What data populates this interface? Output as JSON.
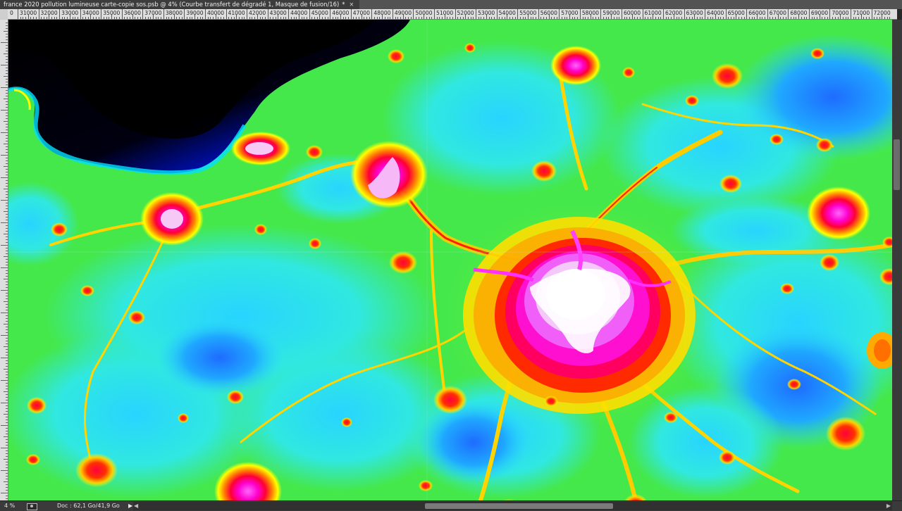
{
  "document_tab": {
    "title": "france 2020 pollution lumineuse carte-copie sos.psb @ 4% (Courbe transfert de dégradé 1, Masque de fusion/16)",
    "modified_marker": "*",
    "close_icon": "close-icon"
  },
  "ruler": {
    "start_label": "0",
    "labels": [
      "31000",
      "32000",
      "33000",
      "34000",
      "35000",
      "36000",
      "37000",
      "38000",
      "39000",
      "40000",
      "41000",
      "42000",
      "43000",
      "44000",
      "45000",
      "46000",
      "47000",
      "48000",
      "49000",
      "50000",
      "51000",
      "52000",
      "53000",
      "54000",
      "55000",
      "56000",
      "57000",
      "58000",
      "59000",
      "60000",
      "61000",
      "62000",
      "63000",
      "64000",
      "65000",
      "66000",
      "67000",
      "68000",
      "69000",
      "70000",
      "71000",
      "72000"
    ]
  },
  "status_bar": {
    "zoom": "4 %",
    "doc_info": "Doc : 62,1 Go/41,9 Go",
    "arrow": "▶",
    "scroll_left": "◀",
    "scroll_right": "▶"
  },
  "canvas": {
    "description_colors": [
      "#000000",
      "#0000ff",
      "#00e5ff",
      "#3cf03c",
      "#ffff00",
      "#ff0000",
      "#ff00ff",
      "#ffffff"
    ]
  }
}
